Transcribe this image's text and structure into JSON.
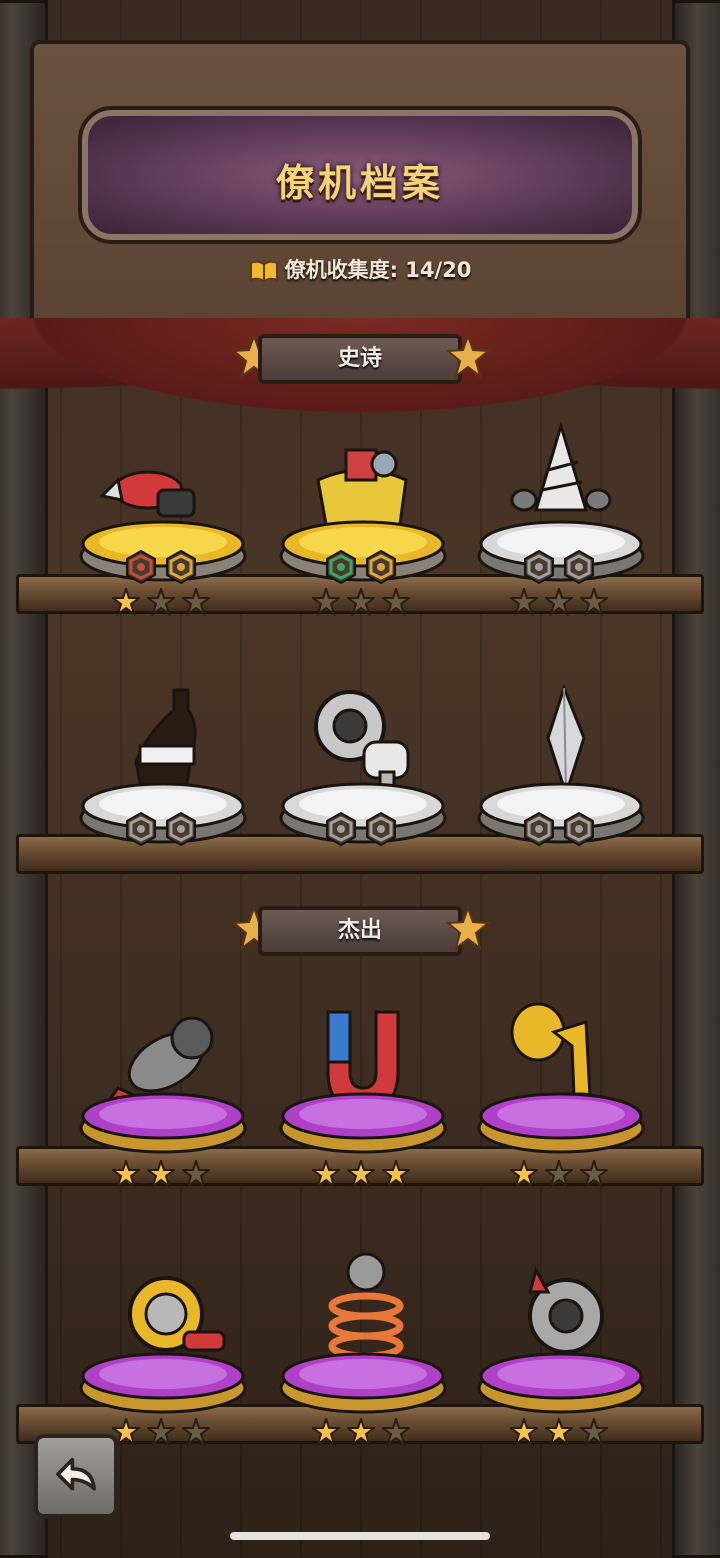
{
  "header": {
    "title": "僚机档案",
    "collection_label": "僚机收集度:",
    "collection_value": "14/20"
  },
  "sections": [
    {
      "label": "史诗"
    },
    {
      "label": "杰出"
    }
  ],
  "wingmen": [
    {
      "id": "red-drill-cannon",
      "rarity": "epic",
      "stars": 1,
      "icons": [
        "gear-red-icon",
        "gear-gold-icon"
      ],
      "pedestal": "gold"
    },
    {
      "id": "toolbag",
      "rarity": "epic",
      "stars": 0,
      "icons": [
        "spiral-green-icon",
        "gear-gold-icon"
      ],
      "pedestal": "gold"
    },
    {
      "id": "drill",
      "rarity": "epic",
      "stars": 0,
      "icons": [
        "swirl-gray-icon",
        "gear-gray-icon"
      ],
      "pedestal": "silver"
    },
    {
      "id": "cola-bottle",
      "rarity": "epic",
      "stars": 0,
      "icons": [
        "swirl-gray-icon",
        "gear-gray-icon"
      ],
      "pedestal": "silver"
    },
    {
      "id": "turbine",
      "rarity": "epic",
      "stars": 0,
      "icons": [
        "rain-gray-icon",
        "gear-gray-icon"
      ],
      "pedestal": "silver"
    },
    {
      "id": "crystal",
      "rarity": "epic",
      "stars": 0,
      "icons": [
        "spiral-gray-icon",
        "gear-gray-icon"
      ],
      "pedestal": "silver"
    },
    {
      "id": "rocket-cannon",
      "rarity": "elite",
      "stars": 2,
      "icons": [],
      "pedestal": "purple"
    },
    {
      "id": "magnet",
      "rarity": "elite",
      "stars": 3,
      "icons": [],
      "pedestal": "purple"
    },
    {
      "id": "horn",
      "rarity": "elite",
      "stars": 1,
      "icons": [],
      "pedestal": "purple"
    },
    {
      "id": "ring-blaster",
      "rarity": "elite",
      "stars": 1,
      "icons": [],
      "pedestal": "purple"
    },
    {
      "id": "spring-orb",
      "rarity": "elite",
      "stars": 2,
      "icons": [],
      "pedestal": "purple"
    },
    {
      "id": "spiked-disc",
      "rarity": "elite",
      "stars": 2,
      "icons": [],
      "pedestal": "purple"
    }
  ],
  "colors": {
    "gold_star": "#f6c24a",
    "empty_star": "#6b5a44",
    "title_text": "#f4d27a"
  }
}
